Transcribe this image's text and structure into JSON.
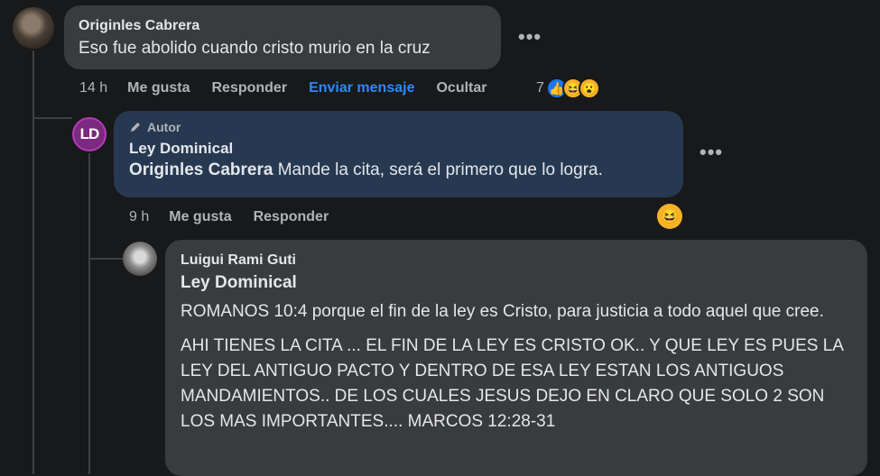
{
  "comments": [
    {
      "author": "Originles Cabrera",
      "text": "Eso fue abolido cuando cristo murio en la cruz",
      "time": "14 h",
      "actions": [
        "Me gusta",
        "Responder",
        "Enviar mensaje",
        "Ocultar"
      ],
      "reaction_count": "7",
      "reactions": [
        "like-icon",
        "haha-icon",
        "wow-icon"
      ]
    },
    {
      "author_badge": "Autor",
      "avatar_initials": "LD",
      "author": "Ley Dominical",
      "mention": "Originles Cabrera",
      "text": "Mande la cita, será el primero que lo logra.",
      "time": "9 h",
      "actions": [
        "Me gusta",
        "Responder"
      ],
      "reactions": [
        "haha-icon"
      ]
    },
    {
      "author": "Luigui Rami Guti",
      "mention": "Ley Dominical",
      "paragraphs": [
        "ROMANOS 10:4 porque el fin de la ley es Cristo, para justicia a todo aquel que cree.",
        "AHI TIENES LA CITA ... EL FIN DE LA LEY ES CRISTO OK.. Y QUE LEY ES PUES LA LEY DEL ANTIGUO PACTO Y DENTRO DE ESA LEY ESTAN LOS ANTIGUOS MANDAMIENTOS.. DE LOS CUALES JESUS DEJO EN CLARO QUE SOLO 2 SON LOS MAS IMPORTANTES.... MARCOS 12:28-31"
      ]
    }
  ],
  "more_label": "•••",
  "colors": {
    "background": "#18191a",
    "bubble": "#3a3b3c",
    "author_bubble": "#263951",
    "link": "#2d88ff"
  }
}
